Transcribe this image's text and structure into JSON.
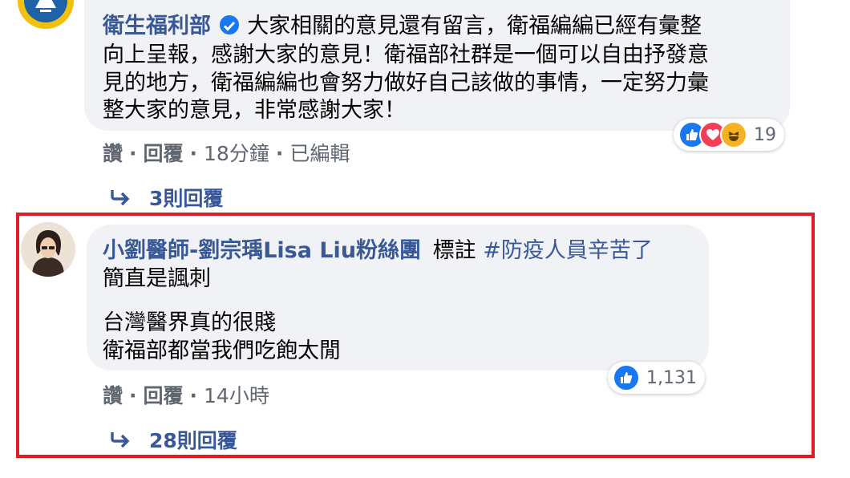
{
  "comment1": {
    "author": "衛生福利部",
    "lines": [
      "大家相關的意見還有留言，衛福編編已經有彙整",
      "向上呈報，感謝大家的意見！衛福部社群是一個可以自由抒發意",
      "見的地方，衛福編編也會努力做好自己該做的事情，一定努力彙",
      "整大家的意見，非常感謝大家！"
    ],
    "actions": {
      "like": "讚",
      "reply": "回覆",
      "time": "18分鐘",
      "edited": "已編輯"
    },
    "reaction_count": "19",
    "replies": "3則回覆"
  },
  "comment2": {
    "author": "小劉醫師-劉宗瑀Lisa Liu粉絲團",
    "tag_prefix": "標註",
    "hashtag": "#防疫人員辛苦了",
    "lines": [
      "簡直是諷刺",
      "台灣醫界真的很賤",
      "衛福部都當我們吃飽太閒"
    ],
    "actions": {
      "like": "讚",
      "reply": "回覆",
      "time": "14小時"
    },
    "reaction_count": "1,131",
    "replies": "28則回覆"
  },
  "colors": {
    "link": "#385898",
    "highlight": "#e21a22",
    "bubble": "#f0f2f5",
    "like_blue": "#1877f2"
  }
}
